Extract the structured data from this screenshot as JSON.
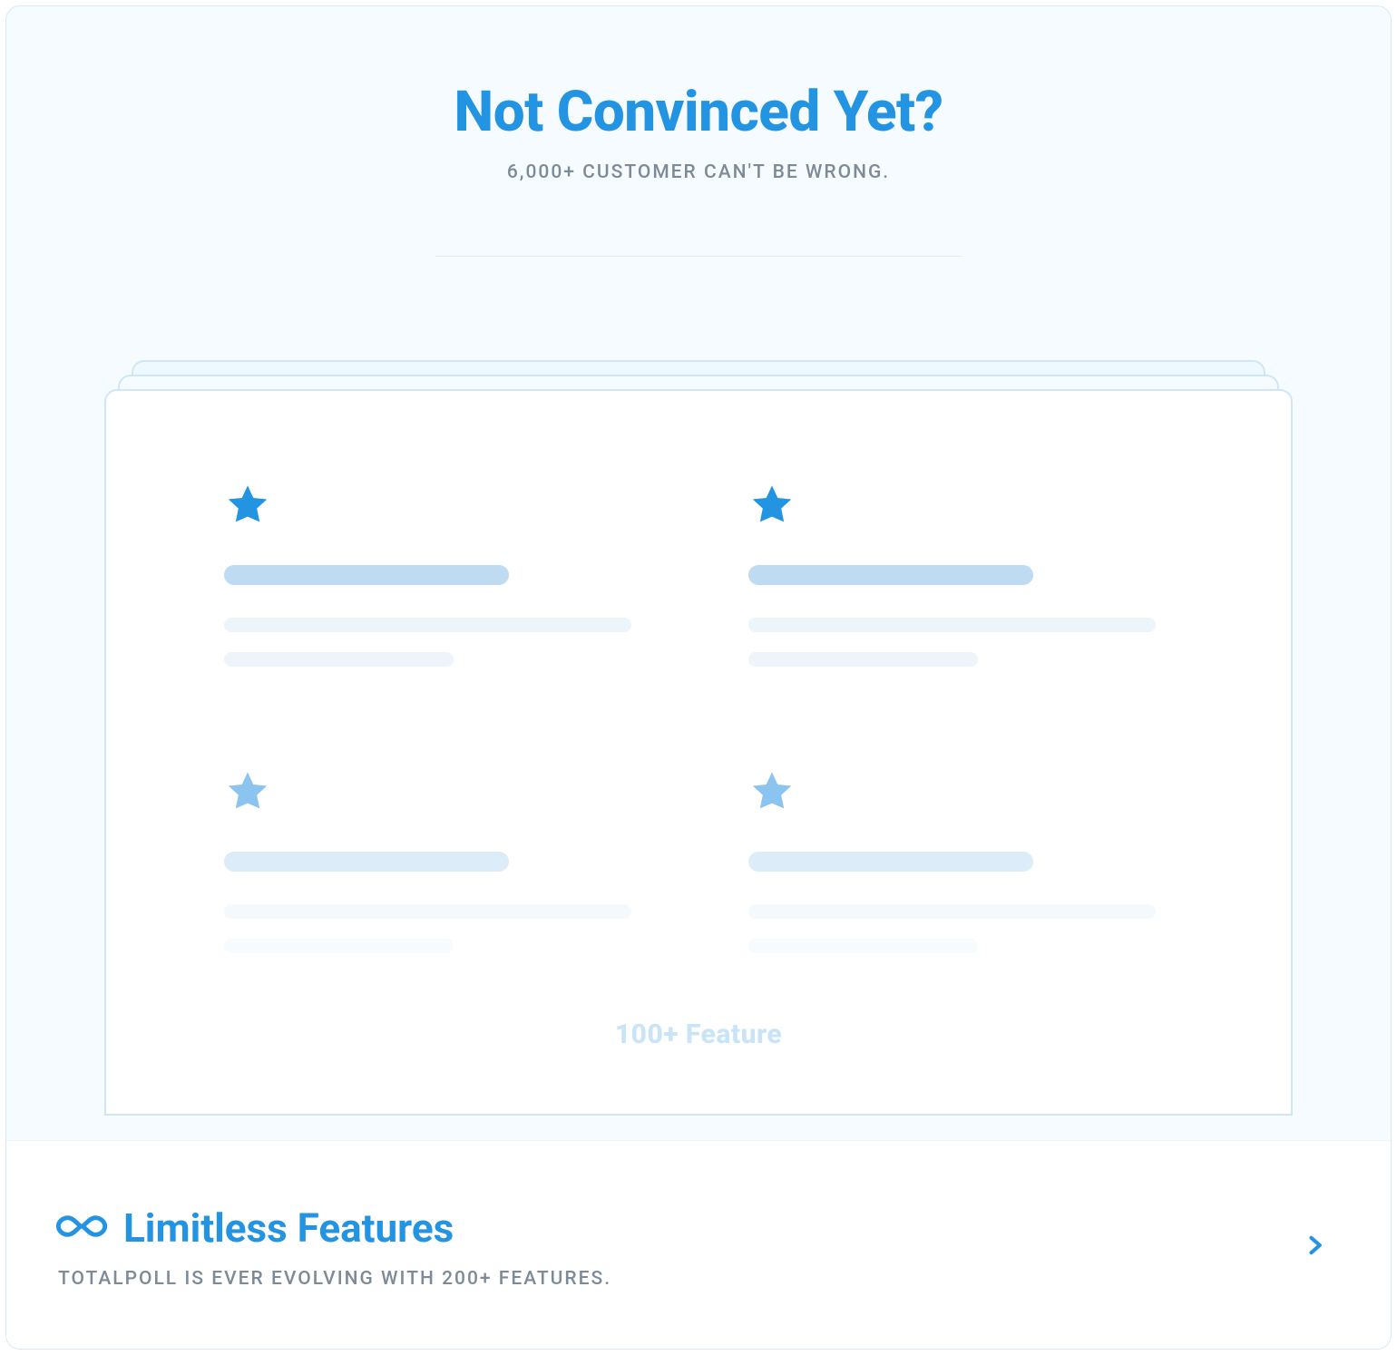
{
  "hero": {
    "title": "Not Convinced Yet?",
    "subtitle": "6,000+ CUSTOMER CAN'T BE WRONG."
  },
  "feature_badge": "100+ Feature",
  "banner": {
    "icon": "infinity-icon",
    "title": "Limitless Features",
    "description": "TOTALPOLL IS EVER EVOLVING WITH 200+ FEATURES.",
    "action_icon": "chevron-right-icon"
  }
}
